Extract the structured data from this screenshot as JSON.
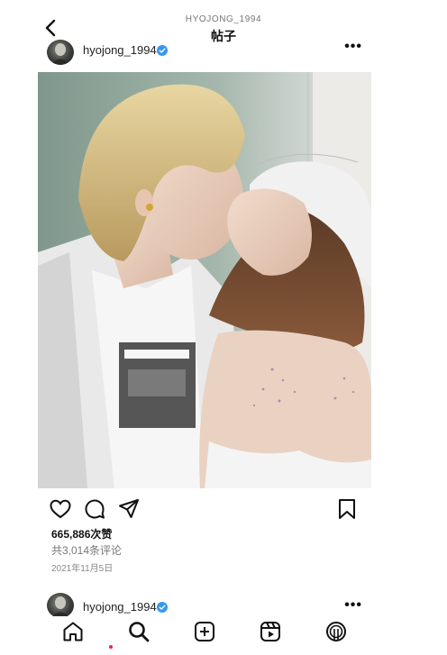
{
  "header": {
    "username": "HYOJONG_1994",
    "title": "帖子"
  },
  "post": {
    "username": "hyojong_1994",
    "likes": "665,886次赞",
    "comments": "共3,014条评论",
    "date": "2021年11月5日"
  },
  "next_post": {
    "username": "hyojong_1994"
  },
  "icons": {
    "back": "chevron-left-icon",
    "more": "more-horizontal-icon",
    "verified": "verified-badge-icon",
    "like": "heart-icon",
    "comment": "comment-icon",
    "share": "send-icon",
    "save": "bookmark-icon",
    "home": "home-icon",
    "search": "search-icon",
    "create": "plus-square-icon",
    "reels": "reels-icon",
    "profile": "profile-icon"
  },
  "colors": {
    "verified": "#3897f0",
    "active_dot": "#e0245e"
  }
}
